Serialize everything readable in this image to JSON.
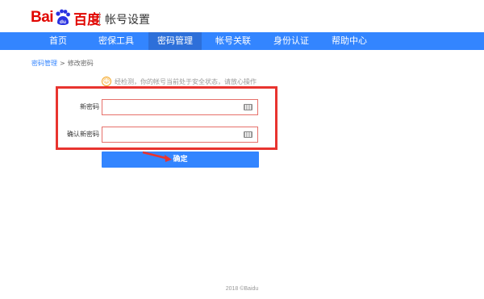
{
  "header": {
    "logo_text_latin": "Bai",
    "logo_text_du": "du",
    "logo_text_cn": "百度",
    "site_title": "帐号设置"
  },
  "nav": {
    "items": [
      {
        "label": "首页"
      },
      {
        "label": "密保工具"
      },
      {
        "label": "密码管理"
      },
      {
        "label": "帐号关联"
      },
      {
        "label": "身份认证"
      },
      {
        "label": "帮助中心"
      }
    ],
    "active": "密码管理"
  },
  "breadcrumb": {
    "parent": "密码管理",
    "separator": ">",
    "current": "修改密码"
  },
  "notice": {
    "text": "经检测，你的帐号当前处于安全状态，请放心操作"
  },
  "form": {
    "new_password_label": "新密码",
    "new_password_value": "",
    "confirm_password_label": "确认新密码",
    "confirm_password_value": "",
    "submit_label": "确定"
  },
  "footer": {
    "copyright": "2018 ©Baidu"
  },
  "colors": {
    "brand_red": "#e10601",
    "nav_blue": "#3385ff",
    "nav_active": "#2d6fd9",
    "annotation_red": "#e8342f"
  }
}
